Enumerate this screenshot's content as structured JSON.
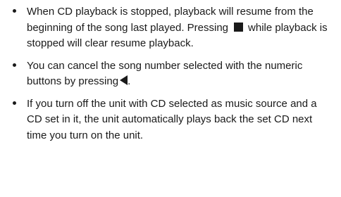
{
  "notes": [
    {
      "text_before": "When CD playback is stopped, playback will resume from the beginning of the song last played. Pressing",
      "icon": "stop-icon",
      "text_after": "while playback is stopped will clear resume playback."
    },
    {
      "text_before": "You can cancel the song number selected with the numeric buttons by pressing",
      "icon": "left-triangle-icon",
      "text_after": "."
    },
    {
      "text": "If you turn off the unit with CD selected as music source and a CD set in it, the unit automatically plays back the set CD next time you turn on the unit."
    }
  ]
}
